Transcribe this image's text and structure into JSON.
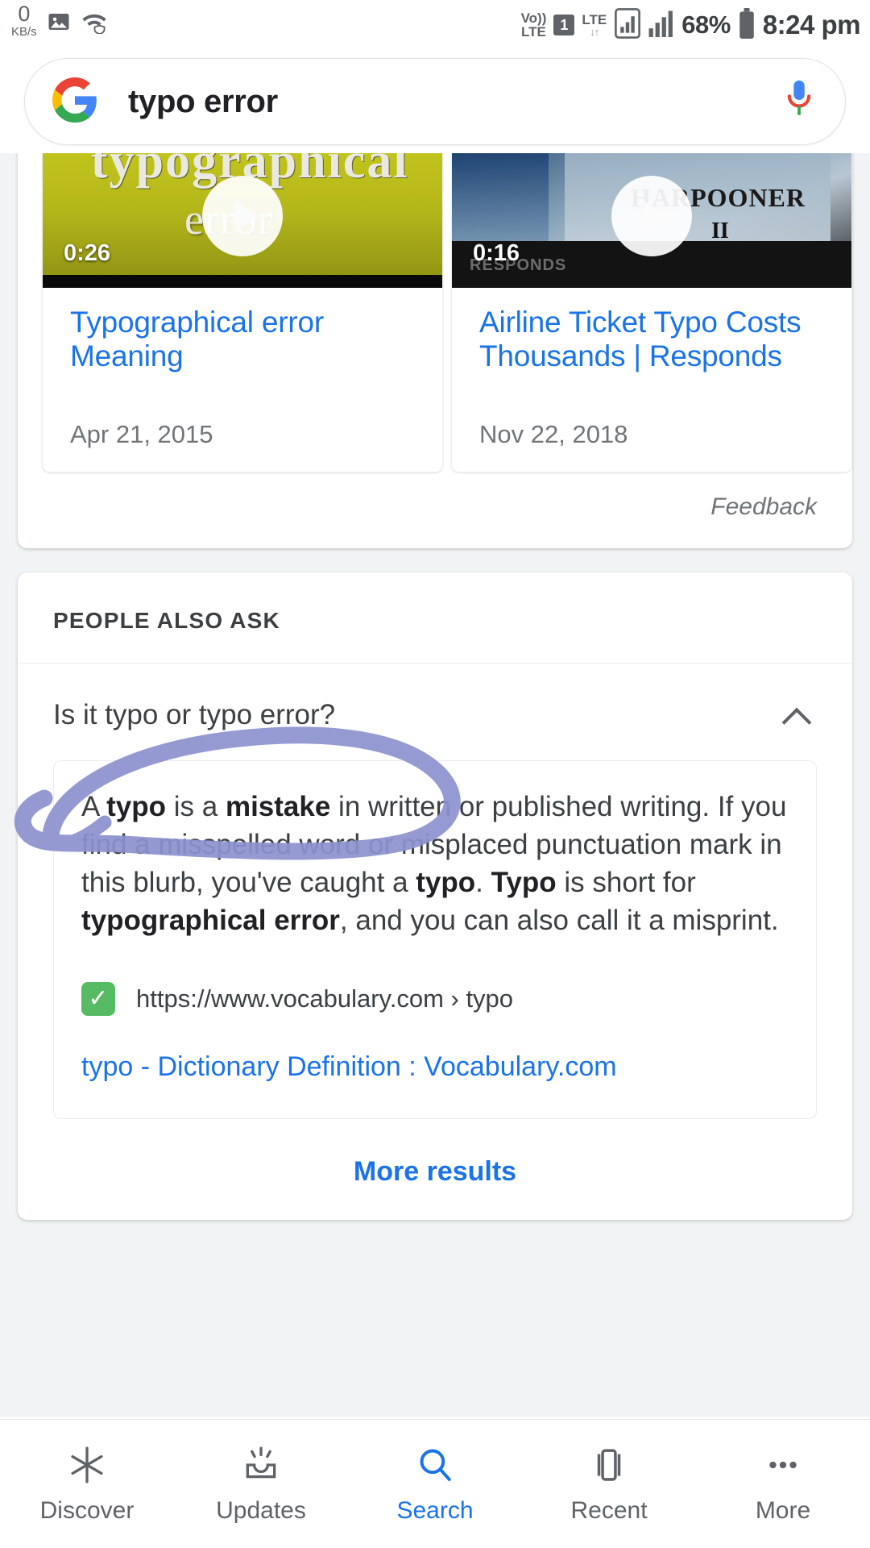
{
  "status_bar": {
    "net_speed_value": "0",
    "net_speed_unit": "KB/s",
    "gallery_icon": "image-icon",
    "wifi_icon": "wifi-shield-icon",
    "volte_top": "Vo))",
    "volte_bottom": "LTE",
    "sim_label": "1",
    "lte_label": "LTE",
    "lte_data_arrows": "↓↑",
    "battery_percent": "68%",
    "battery_icon": "battery-icon",
    "time": "8:24 pm"
  },
  "search": {
    "logo": "google-g-icon",
    "query": "typo error",
    "mic_icon": "microphone-icon"
  },
  "videos": {
    "feedback_label": "Feedback",
    "items": [
      {
        "duration": "0:26",
        "title": "Typographical error Meaning",
        "date": "Apr 21, 2015",
        "thumb_ghost_text": "typographical",
        "thumb_word": "error",
        "play_icon": "play-icon"
      },
      {
        "duration": "0:16",
        "title": "Airline Ticket Typo Costs Thousands | Responds",
        "date": "Nov 22, 2018",
        "thumb_brand": "HARPOONER",
        "thumb_brand2": "II",
        "thumb_sub": "RESPONDS",
        "play_icon": "play-icon"
      }
    ]
  },
  "people_also_ask": {
    "section_label": "PEOPLE ALSO ASK",
    "question": "Is it typo or typo error?",
    "collapse_icon": "chevron-up-icon",
    "answer_parts": [
      {
        "t": "A ",
        "b": false
      },
      {
        "t": "typo",
        "b": true
      },
      {
        "t": " is a ",
        "b": false
      },
      {
        "t": "mistake",
        "b": true
      },
      {
        "t": " in written or published writing. If you find a misspelled word or misplaced punctuation mark in this blurb, you've caught a ",
        "b": false
      },
      {
        "t": "typo",
        "b": true
      },
      {
        "t": ". ",
        "b": false
      },
      {
        "t": "Typo",
        "b": true
      },
      {
        "t": " is short for ",
        "b": false
      },
      {
        "t": "typographical error",
        "b": true
      },
      {
        "t": ", and you can also call it a misprint.",
        "b": false
      }
    ],
    "source_favicon": "green-check-favicon",
    "source_url": "https://www.vocabulary.com › typo",
    "source_title": "typo - Dictionary Definition : Vocabulary.com",
    "more_results_label": "More results"
  },
  "annotation": {
    "shape": "hand-drawn-circle",
    "color": "#8c91cf"
  },
  "bottom_nav": {
    "items": [
      {
        "label": "Discover",
        "icon": "asterisk-icon",
        "active": false
      },
      {
        "label": "Updates",
        "icon": "inbox-burst-icon",
        "active": false
      },
      {
        "label": "Search",
        "icon": "search-icon",
        "active": true
      },
      {
        "label": "Recent",
        "icon": "cards-icon",
        "active": false
      },
      {
        "label": "More",
        "icon": "ellipsis-icon",
        "active": false
      }
    ]
  },
  "colors": {
    "link_blue": "#1a73e8",
    "text_dark": "#3c4043",
    "muted": "#70757a",
    "page_bg": "#f1f3f4"
  }
}
